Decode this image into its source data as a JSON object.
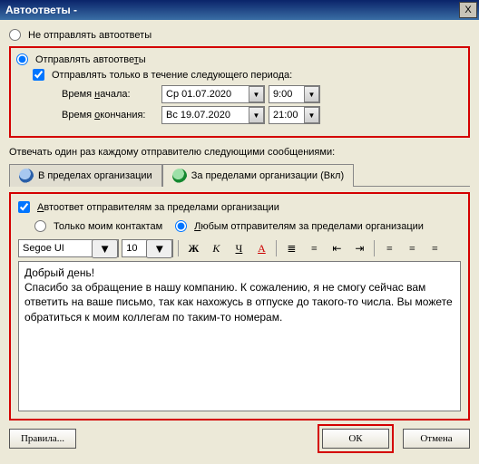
{
  "window": {
    "title": "Автоответы -",
    "close": "X"
  },
  "main": {
    "opt_dont_send": "Не отправлять автоответы",
    "opt_send": "Отправлять автоответы",
    "chk_period": "Отправлять только в течение следующего периода:",
    "start_label": "Время начала:",
    "start_date": "Ср 01.07.2020",
    "start_time": "9:00",
    "end_label": "Время окончания:",
    "end_date": "Вс 19.07.2020",
    "end_time": "21:00",
    "reply_hint": "Отвечать один раз каждому отправителю следующими сообщениями:"
  },
  "tabs": {
    "inside": "В пределах организации",
    "outside": "За пределами организации (Вкл)"
  },
  "outside": {
    "chk_auto": "Автоответ отправителям за пределами организации",
    "opt_contacts": "Только моим контактам",
    "opt_anyone": "Любым отправителям за пределами организации"
  },
  "toolbar": {
    "font": "Segoe UI",
    "size": "10",
    "bold": "Ж",
    "italic": "К",
    "underline": "Ч",
    "color": "A"
  },
  "editor": {
    "line1": "Добрый день!",
    "line2": "Спасибо за обращение в нашу компанию. К сожалению, я не смогу сейчас вам ответить на ваше письмо, так как нахожусь в отпуске до такого-то числа. Вы можете обратиться к моим коллегам по таким-то номерам."
  },
  "buttons": {
    "rules": "Правила...",
    "ok": "ОК",
    "cancel": "Отмена"
  }
}
